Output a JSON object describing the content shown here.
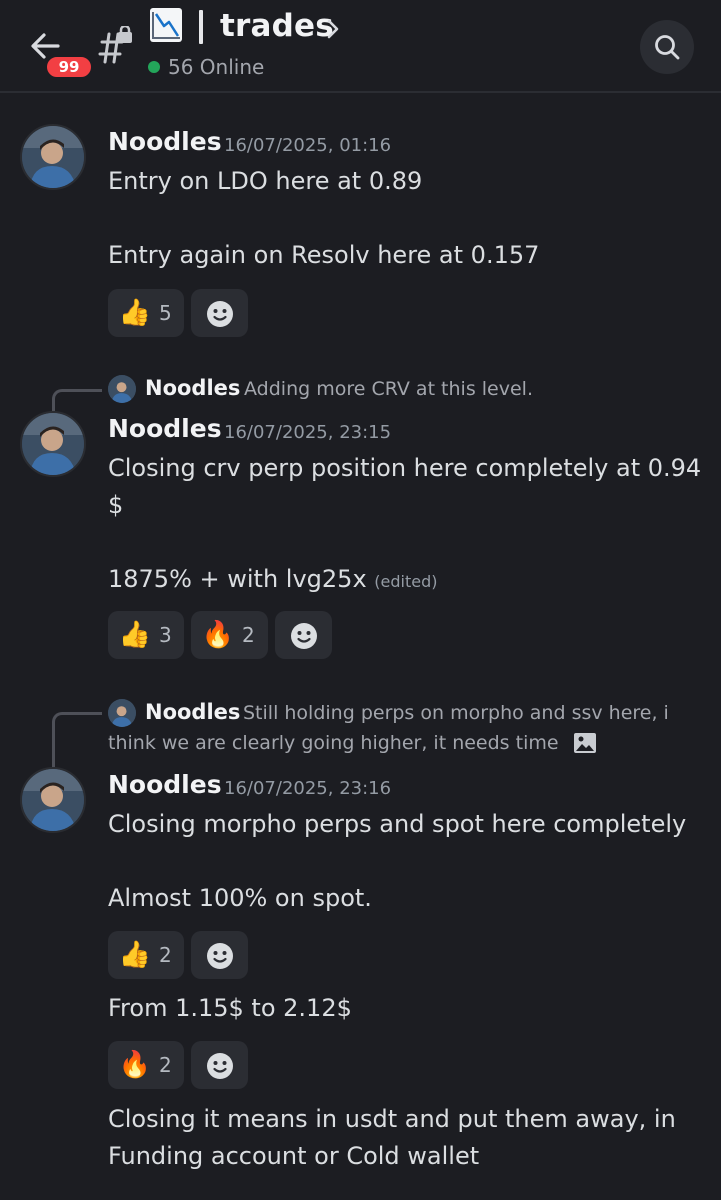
{
  "header": {
    "notification_count": "99",
    "channel_name": "trades",
    "channel_emoji": "chart-decreasing-emoji",
    "online_count": "56 Online"
  },
  "messages": [
    {
      "author": "Noodles",
      "timestamp": "16/07/2025, 01:16",
      "lines": [
        "Entry on LDO here at 0.89",
        "Entry again on Resolv here at 0.157"
      ],
      "reactions": [
        {
          "emoji": "👍",
          "count": "5"
        }
      ]
    },
    {
      "reply": {
        "author": "Noodles",
        "text": "Adding more CRV at this level."
      },
      "author": "Noodles",
      "timestamp": "16/07/2025, 23:15",
      "lines": [
        "Closing crv perp position here completely at 0.94",
        "$",
        "1875% + with lvg25x"
      ],
      "edited": "(edited)",
      "reactions": [
        {
          "emoji": "👍",
          "count": "3"
        },
        {
          "emoji": "🔥",
          "count": "2"
        }
      ]
    },
    {
      "reply": {
        "author": "Noodles",
        "text_line1": "Still holding perps on morpho and ssv here, i",
        "text_line2": "think we are clearly going higher, it needs time"
      },
      "author": "Noodles",
      "timestamp": "16/07/2025, 23:16",
      "lines": [
        "Closing morpho perps and spot here completely",
        "Almost 100% on spot."
      ],
      "reactions": [
        {
          "emoji": "👍",
          "count": "2"
        }
      ]
    },
    {
      "lines": [
        "From 1.15$ to 2.12$"
      ],
      "reactions": [
        {
          "emoji": "🔥",
          "count": "2"
        }
      ]
    },
    {
      "lines": [
        "Closing it means in usdt and put them away, in",
        "Funding account or Cold wallet"
      ]
    }
  ],
  "colors": {
    "background": "#1c1d22",
    "reaction_bg": "#2b2d33",
    "badge": "#f23f43",
    "online": "#23a55a"
  }
}
